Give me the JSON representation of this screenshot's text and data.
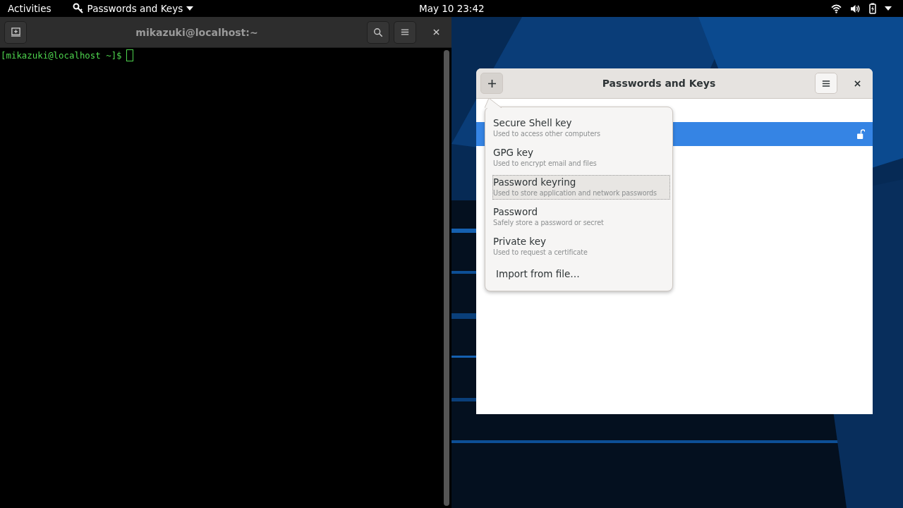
{
  "top_bar": {
    "activities": "Activities",
    "app_menu": "Passwords and Keys",
    "clock": "May 10  23:42"
  },
  "terminal": {
    "title": "mikazuki@localhost:~",
    "prompt": "[mikazuki@localhost ~]$"
  },
  "keys_window": {
    "title": "Passwords and Keys",
    "sidebar": [
      {
        "selected": true,
        "kind": "row"
      }
    ],
    "new_menu": [
      {
        "title": "Secure Shell key",
        "subtitle": "Used to access other computers",
        "focused": false
      },
      {
        "title": "GPG key",
        "subtitle": "Used to encrypt email and files",
        "focused": false
      },
      {
        "title": "Password keyring",
        "subtitle": "Used to store application and network passwords",
        "focused": true
      },
      {
        "title": "Password",
        "subtitle": "Safely store a password or secret",
        "focused": false
      },
      {
        "title": "Private key",
        "subtitle": "Used to request a certificate",
        "focused": false
      }
    ],
    "import": "Import from file…"
  }
}
